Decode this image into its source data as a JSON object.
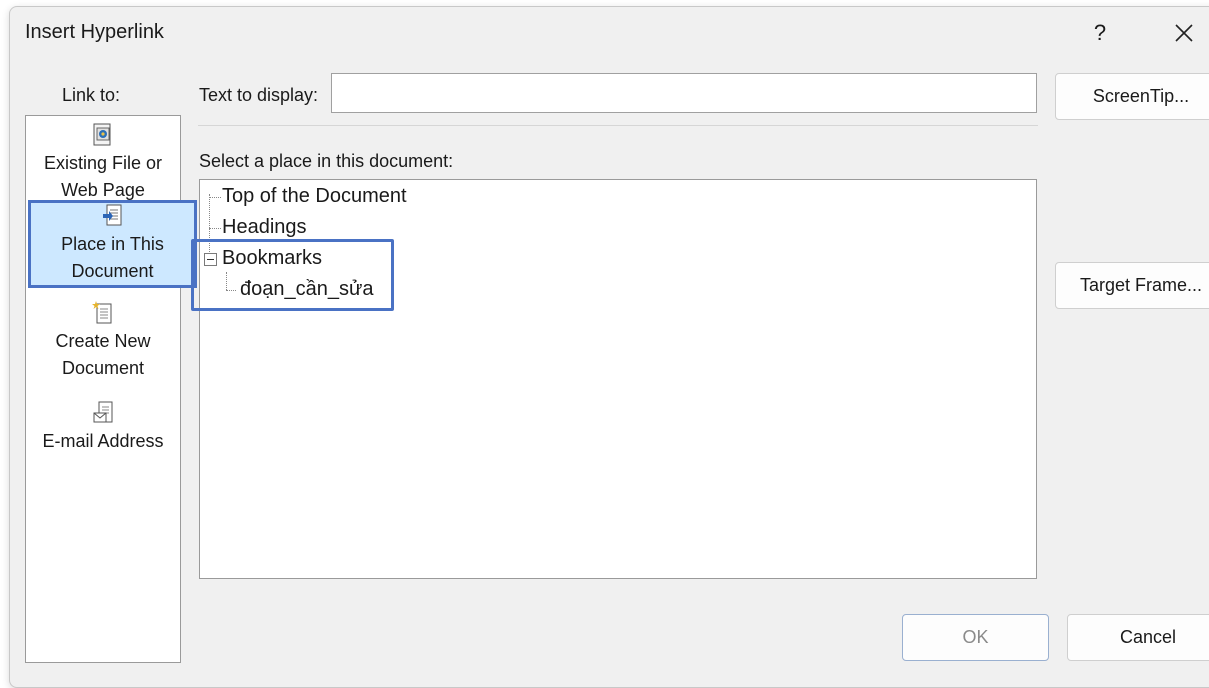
{
  "dialog": {
    "title": "Insert Hyperlink",
    "help_glyph": "?",
    "close_glyph": "×"
  },
  "link_to": {
    "label": "Link to:",
    "items": [
      {
        "line1": "Existing File or",
        "line2": "Web Page",
        "icon": "existing-file-icon"
      },
      {
        "line1": "Place in This",
        "line2": "Document",
        "icon": "place-in-document-icon",
        "selected": true
      },
      {
        "line1": "Create New",
        "line2": "Document",
        "icon": "create-new-document-icon"
      },
      {
        "line1": "E-mail Address",
        "line2": "",
        "icon": "email-address-icon"
      }
    ]
  },
  "text_to_display": {
    "label": "Text to display:",
    "value": ""
  },
  "screentip_label": "ScreenTip...",
  "select_place_label": "Select a place in this document:",
  "tree": {
    "nodes": [
      {
        "label": "Top of the Document",
        "level": 0
      },
      {
        "label": "Headings",
        "level": 0
      },
      {
        "label": "Bookmarks",
        "level": 0,
        "expanded": true
      },
      {
        "label": "đoạn_cần_sửa",
        "level": 1
      }
    ]
  },
  "target_frame_label": "Target Frame...",
  "ok_label": "OK",
  "cancel_label": "Cancel",
  "colors": {
    "selection_fill": "#cde8ff",
    "highlight_border": "#4a72c4"
  }
}
